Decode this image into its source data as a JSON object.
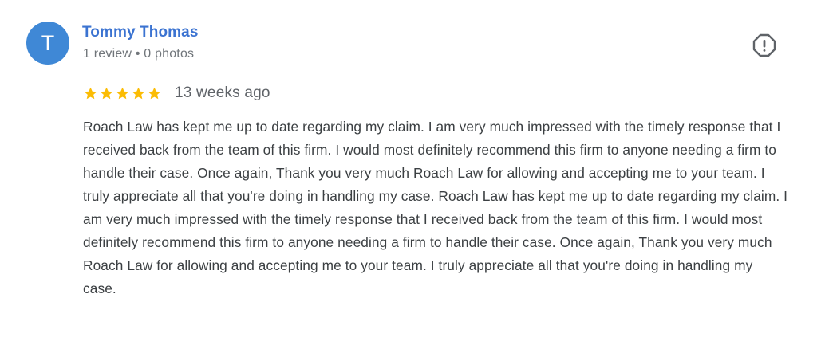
{
  "review": {
    "avatar_initial": "T",
    "reviewer_name": "Tommy Thomas",
    "reviewer_meta": "1 review • 0 photos",
    "rating": 5,
    "rating_max": 5,
    "date": "13 weeks ago",
    "text": "Roach Law has kept me up to date regarding my claim. I am very much impressed with the timely response that I received back from the team of this firm. I would most definitely recommend this firm to anyone needing a firm to handle their case. Once again, Thank you very much Roach Law for allowing and accepting me to your team. I truly appreciate all that you're doing in handling my case. Roach Law has kept me up to date regarding my claim. I am very much impressed with the timely response that I received back from the team of this firm. I would most definitely recommend this firm to anyone needing a firm to handle their case. Once again, Thank you very much Roach Law for allowing and accepting me to your team. I truly appreciate all that you're doing in handling my case."
  },
  "icons": {
    "report": "report-flag-icon",
    "star": "star-icon"
  },
  "colors": {
    "avatar_background": "#3f88d6",
    "reviewer_name": "#3b73d1",
    "star": "#fbbc04",
    "text": "#3c4043",
    "meta": "#70757a"
  }
}
